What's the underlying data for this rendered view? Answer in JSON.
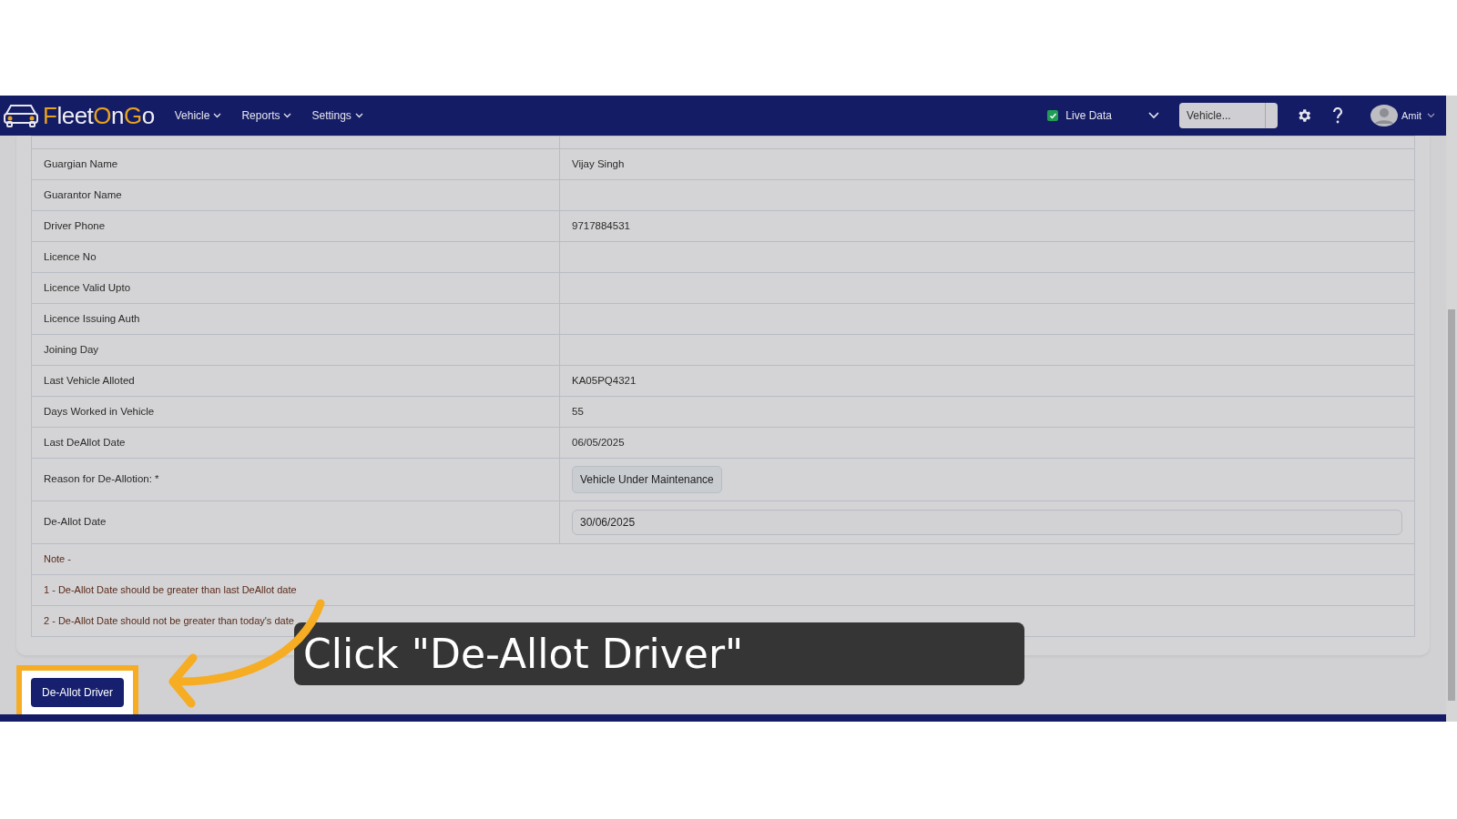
{
  "navbar": {
    "brand": "FleetOnGo",
    "menus": [
      {
        "label": "Vehicle"
      },
      {
        "label": "Reports"
      },
      {
        "label": "Settings"
      }
    ],
    "live_data": {
      "label": "Live Data",
      "checked": true
    },
    "vehicle_select": {
      "value": "Vehicle..."
    },
    "user": "Amit"
  },
  "details": [
    {
      "kind": "text",
      "label": "Guargian Name",
      "value": "Vijay Singh"
    },
    {
      "kind": "text",
      "label": "Guarantor Name"
    },
    {
      "kind": "text",
      "label": "Driver Phone",
      "value": "9717884531"
    },
    {
      "kind": "text",
      "label": "Licence No"
    },
    {
      "kind": "text",
      "label": "Licence Valid Upto"
    },
    {
      "kind": "text",
      "label": "Licence Issuing Auth"
    },
    {
      "kind": "text",
      "label": "Joining Day"
    },
    {
      "kind": "text",
      "label": "Last Vehicle Alloted",
      "value": "KA05PQ4321"
    },
    {
      "kind": "text",
      "label": "Days Worked in Vehicle",
      "value": "55"
    },
    {
      "kind": "text",
      "label": "Last DeAllot Date",
      "value": "06/05/2025"
    },
    {
      "kind": "select",
      "label": "Reason for De-Allotion: *",
      "value": "Vehicle Under Maintenance"
    },
    {
      "kind": "input",
      "label": "De-Allot Date",
      "value": "30/06/2025"
    },
    {
      "kind": "note",
      "label": "Note -"
    },
    {
      "kind": "note",
      "label": "1 - De-Allot Date should be greater than last DeAllot date"
    },
    {
      "kind": "note",
      "label": "2 - De-Allot Date should not be greater than today's date"
    }
  ],
  "action_button": "De-Allot Driver",
  "callout": {
    "text": "Click \"De-Allot Driver\""
  }
}
